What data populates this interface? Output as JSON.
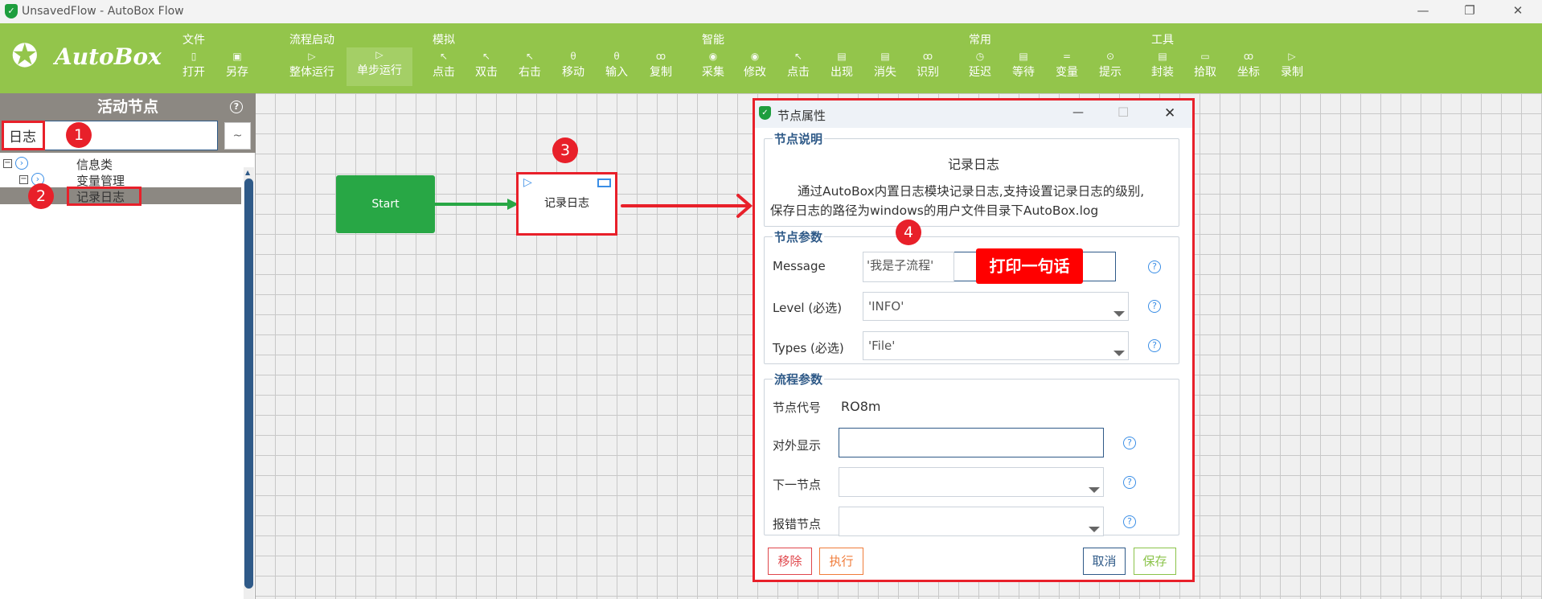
{
  "window": {
    "title": "UnsavedFlow - AutoBox Flow",
    "minimize": "—",
    "restore": "❐",
    "close": "✕"
  },
  "toolbar": {
    "logo": "AutoBox",
    "groups": [
      "文件",
      "流程启动",
      "模拟",
      "智能",
      "常用",
      "工具"
    ],
    "items": [
      {
        "label": "打开",
        "icon": "open-icon",
        "glyph": "▯"
      },
      {
        "label": "另存",
        "icon": "save-icon",
        "glyph": "▣"
      },
      {
        "label": "整体运行",
        "icon": "run-icon",
        "glyph": "▷"
      },
      {
        "label": "单步运行",
        "icon": "step-run-icon",
        "glyph": "▷",
        "active": true
      },
      {
        "label": "点击",
        "icon": "cursor-icon",
        "glyph": "↖"
      },
      {
        "label": "双击",
        "icon": "cursor-icon",
        "glyph": "↖"
      },
      {
        "label": "右击",
        "icon": "cursor-icon",
        "glyph": "↖"
      },
      {
        "label": "移动",
        "icon": "mouse-icon",
        "glyph": "θ"
      },
      {
        "label": "输入",
        "icon": "mouse-icon",
        "glyph": "θ"
      },
      {
        "label": "复制",
        "icon": "glasses-icon",
        "glyph": "ꝏ"
      },
      {
        "label": "采集",
        "icon": "eye-icon",
        "glyph": "◉"
      },
      {
        "label": "修改",
        "icon": "eye-icon",
        "glyph": "◉"
      },
      {
        "label": "点击",
        "icon": "cursor-icon",
        "glyph": "↖"
      },
      {
        "label": "出现",
        "icon": "calendar-clock-icon",
        "glyph": "▤"
      },
      {
        "label": "消失",
        "icon": "calendar-clock-icon",
        "glyph": "▤"
      },
      {
        "label": "识别",
        "icon": "glasses-icon",
        "glyph": "ꝏ"
      },
      {
        "label": "延迟",
        "icon": "clock-icon",
        "glyph": "◷"
      },
      {
        "label": "等待",
        "icon": "calendar-clock-icon",
        "glyph": "▤"
      },
      {
        "label": "变量",
        "icon": "equals-icon",
        "glyph": "="
      },
      {
        "label": "提示",
        "icon": "info-circle-icon",
        "glyph": "⊙"
      },
      {
        "label": "封装",
        "icon": "document-icon",
        "glyph": "▤"
      },
      {
        "label": "拾取",
        "icon": "monitor-icon",
        "glyph": "▭"
      },
      {
        "label": "坐标",
        "icon": "glasses-icon",
        "glyph": "ꝏ"
      },
      {
        "label": "录制",
        "icon": "record-icon",
        "glyph": "▷"
      }
    ]
  },
  "sidebar": {
    "title": "活动节点",
    "help": "?",
    "search_value": "日志",
    "tilde": "~",
    "tree": [
      {
        "label": "信息类",
        "expand": "−"
      },
      {
        "label": "变量管理",
        "expand": "−"
      },
      {
        "label": "记录日志",
        "selected": true
      }
    ]
  },
  "canvas": {
    "start": "Start",
    "node": "记录日志"
  },
  "annotations": [
    "1",
    "2",
    "3",
    "4"
  ],
  "dialog": {
    "title": "节点属性",
    "minimize": "—",
    "maximize": "☐",
    "close": "✕",
    "desc": {
      "legend": "节点说明",
      "title": "记录日志",
      "line1": "通过AutoBox内置日志模块记录日志,支持设置记录日志的级别,",
      "line2": "保存日志的路径为windows的用户文件目录下AutoBox.log"
    },
    "params": {
      "legend": "节点参数",
      "message_label": "Message",
      "message_value": "'我是子流程'",
      "overlay": "打印一句话",
      "level_label": "Level (必选)",
      "level_value": "'INFO'",
      "types_label": "Types (必选)",
      "types_value": "'File'"
    },
    "flow": {
      "legend": "流程参数",
      "code_label": "节点代号",
      "code_value": "RO8m",
      "display_label": "对外显示",
      "display_value": "",
      "next_label": "下一节点",
      "next_value": "",
      "error_label": "报错节点",
      "error_value": ""
    },
    "buttons": {
      "remove": "移除",
      "execute": "执行",
      "cancel": "取消",
      "save": "保存"
    },
    "colors": {
      "remove": "#e0474c",
      "execute": "#f07c3a",
      "cancel": "#2f5a88",
      "save": "#8bc34a"
    }
  },
  "colors": {
    "toolbar": "#93c54b",
    "sidebar_header": "#8c8882",
    "start_node": "#28a745",
    "annotation": "#e8202a",
    "accent": "#2f5a88"
  }
}
